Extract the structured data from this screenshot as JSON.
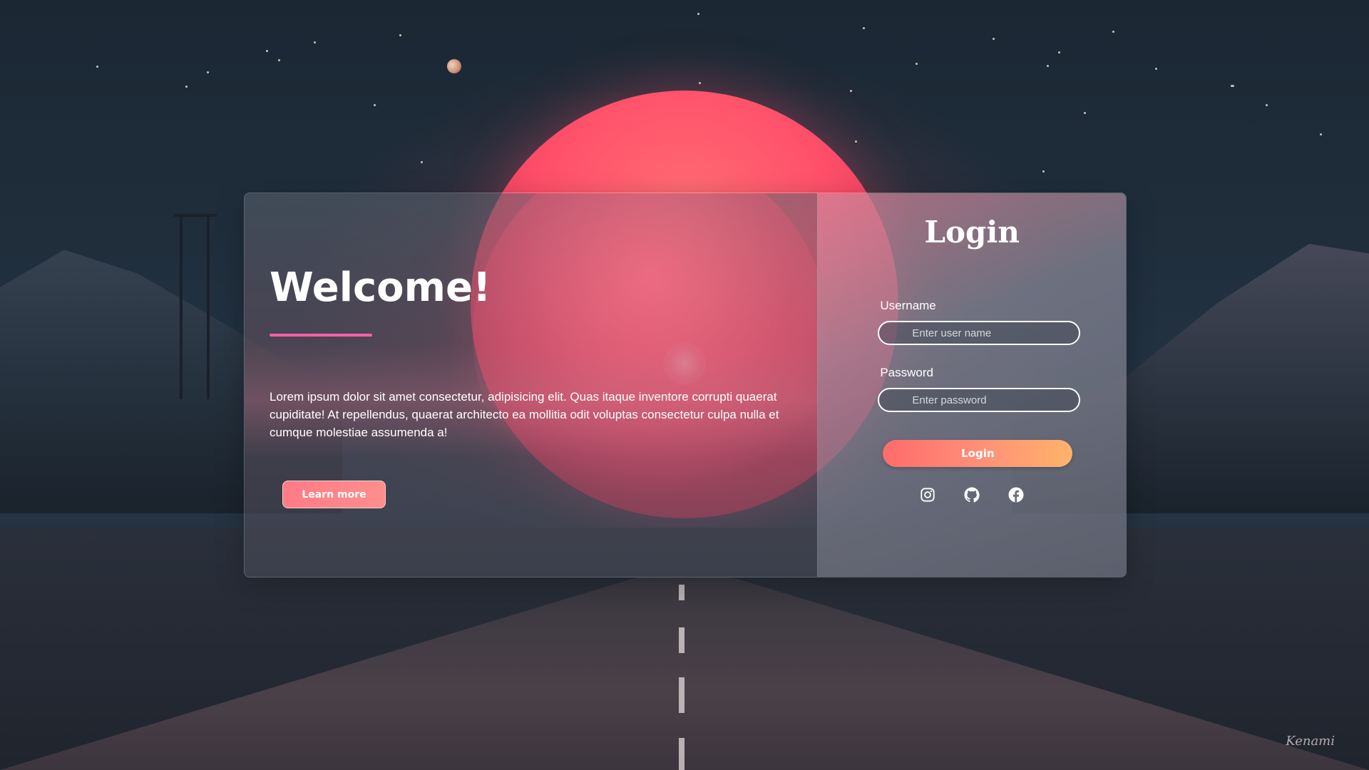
{
  "welcome": {
    "title": "Welcome!",
    "body": "Lorem ipsum dolor sit amet consectetur, adipisicing elit. Quas itaque inventore corrupti quaerat cupiditate! At repellendus, quaerat architecto ea mollitia odit voluptas consectetur culpa nulla et cumque molestiae assumenda a!",
    "learn_more_label": "Learn more"
  },
  "login": {
    "title": "Login",
    "username": {
      "label": "Username",
      "placeholder": "Enter user name",
      "value": ""
    },
    "password": {
      "label": "Password",
      "placeholder": "Enter password",
      "value": ""
    },
    "submit_label": "Login",
    "socials": [
      {
        "name": "instagram-icon"
      },
      {
        "name": "github-icon"
      },
      {
        "name": "facebook-icon"
      }
    ]
  },
  "artist_signature": "Kenami",
  "colors": {
    "accent_pink": "#ff5fa8",
    "button_gradient_start": "#ff6b6b",
    "button_gradient_end": "#ffb36a",
    "learn_more_bg": "#ff7b86",
    "planet": "#ff4f6a"
  }
}
